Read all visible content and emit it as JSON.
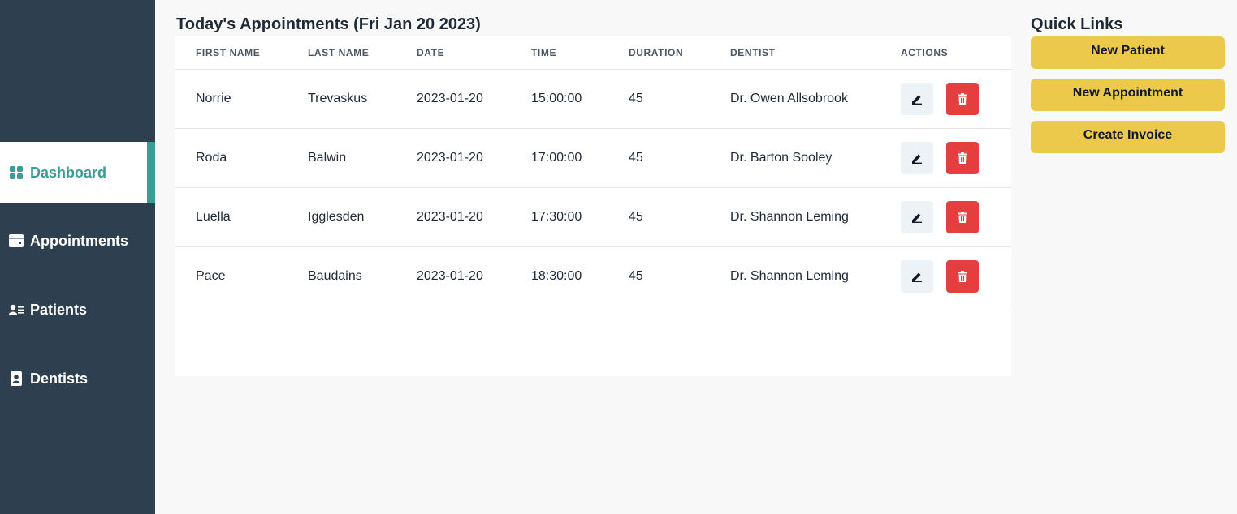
{
  "sidebar": {
    "items": [
      {
        "label": "Dashboard",
        "icon": "dashboard-icon",
        "active": true
      },
      {
        "label": "Appointments",
        "icon": "calendar-icon",
        "active": false
      },
      {
        "label": "Patients",
        "icon": "patients-icon",
        "active": false
      },
      {
        "label": "Dentists",
        "icon": "dentist-id-icon",
        "active": false
      }
    ]
  },
  "main": {
    "title": "Today's Appointments (Fri Jan 20 2023)",
    "table": {
      "columns": [
        "FIRST NAME",
        "LAST NAME",
        "DATE",
        "TIME",
        "DURATION",
        "DENTIST",
        "ACTIONS"
      ],
      "rows": [
        {
          "first_name": "Norrie",
          "last_name": "Trevaskus",
          "date": "2023-01-20",
          "time": "15:00:00",
          "duration": "45",
          "dentist": "Dr. Owen Allsobrook"
        },
        {
          "first_name": "Roda",
          "last_name": "Balwin",
          "date": "2023-01-20",
          "time": "17:00:00",
          "duration": "45",
          "dentist": "Dr. Barton Sooley"
        },
        {
          "first_name": "Luella",
          "last_name": "Igglesden",
          "date": "2023-01-20",
          "time": "17:30:00",
          "duration": "45",
          "dentist": "Dr. Shannon Leming"
        },
        {
          "first_name": "Pace",
          "last_name": "Baudains",
          "date": "2023-01-20",
          "time": "18:30:00",
          "duration": "45",
          "dentist": "Dr. Shannon Leming"
        }
      ]
    }
  },
  "quick_links": {
    "title": "Quick Links",
    "buttons": [
      "New Patient",
      "New Appointment",
      "Create Invoice"
    ]
  },
  "colors": {
    "sidebar_bg": "#2e3f4f",
    "accent": "#3a9c97",
    "quick_link_bg": "#ecc94b",
    "delete_bg": "#e53e3e",
    "edit_bg": "#edf2f7"
  }
}
